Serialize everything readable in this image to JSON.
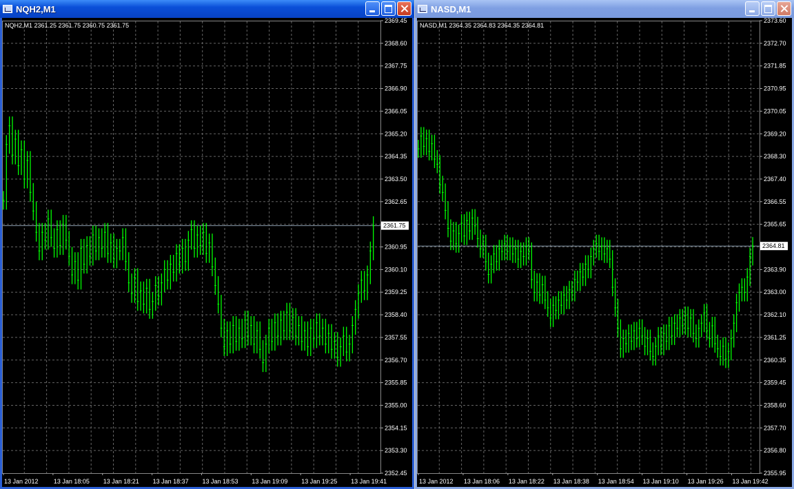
{
  "colors": {
    "background": "#000000",
    "grid": "#666666",
    "candle": "#00ff00",
    "axis_text": "#ffffff",
    "price_line": "#8899aa"
  },
  "windows": [
    {
      "title": "NQH2,M1",
      "info": "NQH2,M1  2361.25 2361.75 2360.75 2361.75",
      "buttons": [
        "minimize-icon",
        "maximize-icon",
        "close-icon"
      ],
      "chart_data": {
        "type": "line",
        "title": "",
        "symbol": "NQH2",
        "timeframe": "M1",
        "yticks": [
          "2369.45",
          "2368.60",
          "2367.75",
          "2366.90",
          "2366.05",
          "2365.20",
          "2364.35",
          "2363.50",
          "2362.65",
          "2361.80",
          "2360.95",
          "2360.10",
          "2359.25",
          "2358.40",
          "2357.55",
          "2356.70",
          "2355.85",
          "2355.00",
          "2354.15",
          "2353.30",
          "2352.45"
        ],
        "ylim": [
          2352.45,
          2369.45
        ],
        "xticks": [
          "13 Jan 2012",
          "13 Jan 18:05",
          "13 Jan 18:21",
          "13 Jan 18:37",
          "13 Jan 18:53",
          "13 Jan 19:09",
          "13 Jan 19:25",
          "13 Jan 19:41"
        ],
        "current_price": "2361.75",
        "current_value": 2361.75,
        "y": [
          2362.7,
          2364.8,
          2365.5,
          2364.4,
          2365.0,
          2364.0,
          2364.6,
          2363.5,
          2364.2,
          2363.0,
          2362.3,
          2361.5,
          2360.8,
          2361.5,
          2361.2,
          2362.0,
          2361.3,
          2360.9,
          2361.6,
          2361.0,
          2361.8,
          2361.2,
          2360.6,
          2359.9,
          2360.4,
          2359.7,
          2360.9,
          2360.3,
          2361.0,
          2360.6,
          2361.4,
          2360.8,
          2361.3,
          2360.9,
          2361.5,
          2360.7,
          2361.1,
          2360.5,
          2360.9,
          2360.8,
          2361.3,
          2360.4,
          2359.6,
          2359.2,
          2359.8,
          2358.9,
          2359.3,
          2358.8,
          2359.4,
          2358.6,
          2358.9,
          2359.5,
          2359.1,
          2359.6,
          2360.1,
          2359.7,
          2360.3,
          2360.0,
          2360.7,
          2360.3,
          2360.9,
          2360.4,
          2361.2,
          2361.6,
          2360.9,
          2361.4,
          2361.0,
          2361.5,
          2360.7,
          2361.1,
          2360.2,
          2359.5,
          2358.8,
          2357.9,
          2357.2,
          2357.8,
          2357.3,
          2358.0,
          2357.4,
          2357.9,
          2357.5,
          2358.2,
          2357.6,
          2358.0,
          2357.3,
          2357.8,
          2357.1,
          2356.6,
          2357.3,
          2357.9,
          2357.4,
          2358.1,
          2357.6,
          2358.2,
          2357.8,
          2358.5,
          2357.8,
          2358.3,
          2357.6,
          2358.0,
          2357.4,
          2357.8,
          2357.2,
          2357.9,
          2357.5,
          2358.1,
          2357.6,
          2357.9,
          2357.3,
          2357.7,
          2357.1,
          2357.4,
          2356.8,
          2357.2,
          2357.6,
          2357.0,
          2357.3,
          2358.0,
          2358.6,
          2359.2,
          2359.7,
          2359.3,
          2359.9,
          2360.8,
          2361.75
        ]
      }
    },
    {
      "title": "NASD,M1",
      "info": "NASD,M1  2364.35 2364.83 2364.35 2364.81",
      "buttons": [
        "minimize-icon",
        "maximize-icon",
        "close-icon"
      ],
      "chart_data": {
        "type": "line",
        "title": "",
        "symbol": "NASD",
        "timeframe": "M1",
        "yticks": [
          "2373.60",
          "2372.70",
          "2371.85",
          "2370.95",
          "2370.05",
          "2369.20",
          "2368.30",
          "2367.40",
          "2366.55",
          "2365.65",
          "2364.75",
          "2363.90",
          "2363.00",
          "2362.10",
          "2361.25",
          "2360.35",
          "2359.45",
          "2358.60",
          "2357.70",
          "2356.80",
          "2355.95"
        ],
        "ylim": [
          2355.95,
          2373.6
        ],
        "xticks": [
          "13 Jan 2012",
          "13 Jan 18:06",
          "13 Jan 18:22",
          "13 Jan 18:38",
          "13 Jan 18:54",
          "13 Jan 19:10",
          "13 Jan 19:26",
          "13 Jan 19:42"
        ],
        "current_price": "2364.81",
        "current_value": 2364.81,
        "y": [
          2368.6,
          2369.1,
          2368.7,
          2369.0,
          2368.5,
          2368.8,
          2368.2,
          2368.0,
          2367.2,
          2366.9,
          2366.2,
          2365.5,
          2365.0,
          2365.4,
          2364.9,
          2365.3,
          2365.7,
          2365.2,
          2365.8,
          2365.4,
          2365.9,
          2365.6,
          2365.1,
          2364.7,
          2364.9,
          2364.2,
          2363.7,
          2364.1,
          2364.5,
          2364.2,
          2364.7,
          2364.6,
          2364.9,
          2364.6,
          2364.8,
          2364.5,
          2364.7,
          2364.3,
          2364.6,
          2364.4,
          2364.8,
          2364.6,
          2363.5,
          2363.0,
          2363.4,
          2362.9,
          2363.3,
          2362.7,
          2362.4,
          2362.0,
          2362.5,
          2362.3,
          2362.7,
          2362.5,
          2362.9,
          2362.7,
          2363.1,
          2363.0,
          2363.5,
          2363.4,
          2363.8,
          2363.6,
          2364.1,
          2363.9,
          2364.4,
          2364.7,
          2364.9,
          2364.6,
          2364.8,
          2364.5,
          2364.7,
          2364.3,
          2363.2,
          2362.4,
          2361.6,
          2360.8,
          2361.2,
          2361.0,
          2361.4,
          2361.1,
          2361.5,
          2361.2,
          2361.6,
          2361.3,
          2360.9,
          2361.2,
          2360.7,
          2360.5,
          2360.9,
          2361.3,
          2360.9,
          2361.4,
          2361.1,
          2361.7,
          2361.3,
          2361.8,
          2361.6,
          2362.0,
          2361.7,
          2362.1,
          2361.6,
          2362.0,
          2361.4,
          2361.2,
          2361.6,
          2361.8,
          2362.2,
          2361.5,
          2361.2,
          2361.7,
          2361.0,
          2360.8,
          2360.5,
          2360.9,
          2360.4,
          2360.7,
          2361.2,
          2361.8,
          2362.6,
          2363.0,
          2363.2,
          2363.0,
          2363.6,
          2364.4,
          2364.81
        ]
      }
    }
  ]
}
